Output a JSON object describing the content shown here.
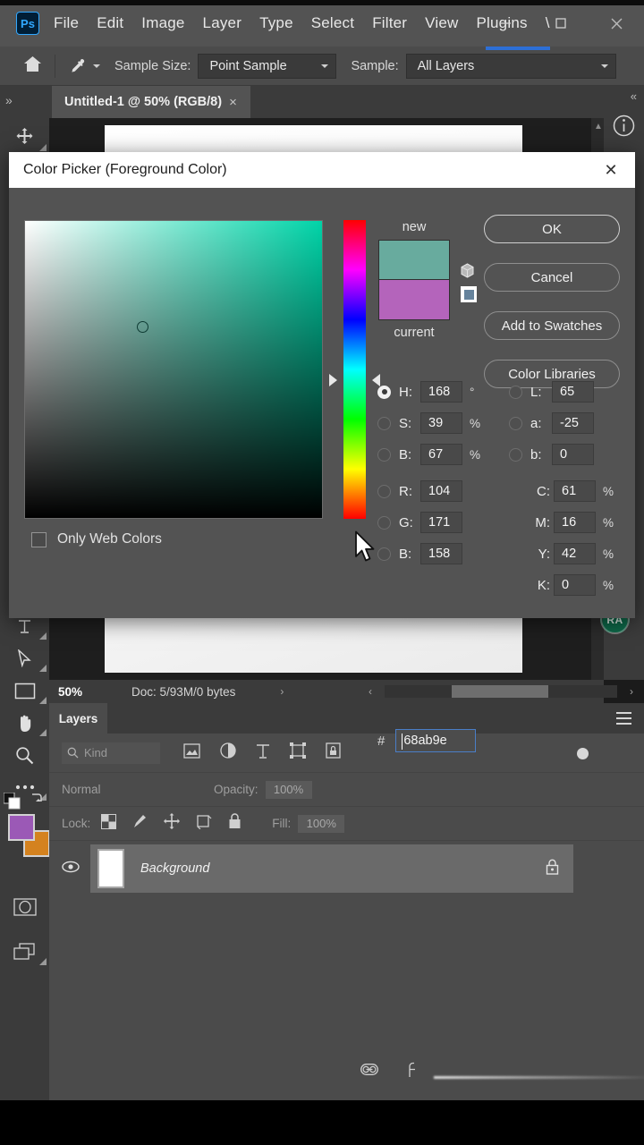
{
  "app": {
    "logo_text": "Ps",
    "menu_items": [
      "File",
      "Edit",
      "Image",
      "Layer",
      "Type",
      "Select",
      "Filter",
      "View",
      "Plugins",
      "\\"
    ],
    "window_controls": {
      "minimize": "minimize-icon",
      "maximize": "maximize-icon",
      "close": "close-icon"
    }
  },
  "options_bar": {
    "home_icon": "home-icon",
    "tool_icon": "eyedropper-icon",
    "sample_size_label": "Sample Size:",
    "sample_size_value": "Point Sample",
    "sample_label": "Sample:",
    "sample_value": "All Layers"
  },
  "document": {
    "tab_title": "Untitled-1 @ 50% (RGB/8)",
    "tab_close": "×",
    "expand_left": "»",
    "expand_right": "«"
  },
  "status_bar": {
    "zoom": "50%",
    "doc_info": "Doc: 5/93M/0 bytes",
    "chevron": "›",
    "scroll_left": "‹",
    "scroll_right": "›"
  },
  "toolbar": {
    "tools": [
      {
        "name": "move-tool",
        "glyph": "✥"
      },
      {
        "name": "type-tool",
        "glyph": "⊥"
      },
      {
        "name": "path-selection-tool",
        "glyph": "➤"
      },
      {
        "name": "rectangle-tool",
        "glyph": "▭"
      },
      {
        "name": "hand-tool",
        "glyph": "✋"
      },
      {
        "name": "zoom-tool",
        "glyph": "⌕"
      },
      {
        "name": "more-tools",
        "glyph": "•••"
      }
    ],
    "foreground_color": "#9b59b6",
    "background_color": "#d4821f",
    "swap_icon": "swap-colors-icon",
    "quick_mask": "quick-mask-icon",
    "screen_mode": "screen-mode-icon"
  },
  "right_dock": {
    "info_icon": "info-icon",
    "collapse": "«",
    "badge_text": "RA"
  },
  "layers_panel": {
    "tab_label": "Layers",
    "menu_icon": "panel-menu-icon",
    "filter_kind": "Kind",
    "filter_icons": [
      "pixel-filter-icon",
      "adjustment-filter-icon",
      "type-filter-icon",
      "shape-filter-icon",
      "smart-object-filter-icon"
    ],
    "blend_mode": "Normal",
    "opacity_label": "Opacity:",
    "opacity_value": "100%",
    "lock_label": "Lock:",
    "lock_icons": [
      "lock-transparent-icon",
      "lock-image-icon",
      "lock-position-icon",
      "lock-artboard-icon",
      "lock-all-icon"
    ],
    "fill_label": "Fill:",
    "fill_value": "100%",
    "rows": [
      {
        "name": "Background",
        "visible": true,
        "locked": true,
        "thumb_color": "#ffffff"
      }
    ],
    "footer_icons": [
      "link-layers-icon",
      "layer-fx-icon"
    ]
  },
  "color_picker": {
    "title": "Color Picker (Foreground Color)",
    "close_label": "✕",
    "buttons": [
      {
        "label": "OK",
        "name": "ok-button",
        "primary": true
      },
      {
        "label": "Cancel",
        "name": "cancel-button",
        "primary": false
      },
      {
        "label": "Add to Swatches",
        "name": "add-to-swatches-button",
        "primary": false
      },
      {
        "label": "Color Libraries",
        "name": "color-libraries-button",
        "primary": false
      }
    ],
    "new_label": "new",
    "current_label": "current",
    "new_color": "#68ab9e",
    "current_color": "#b濟",
    "current_color_hex": "#b464bb",
    "only_web_colors_label": "Only Web Colors",
    "only_web_colors_checked": false,
    "field_hue_color": "#00d4a8",
    "selected_model": "H",
    "hsb": {
      "h_label": "H:",
      "h_value": "168",
      "h_unit": "°",
      "s_label": "S:",
      "s_value": "39",
      "s_unit": "%",
      "b_label": "B:",
      "b_value": "67",
      "b_unit": "%"
    },
    "lab": {
      "l_label": "L:",
      "l_value": "65",
      "a_label": "a:",
      "a_value": "-25",
      "b_label": "b:",
      "b_value": "0"
    },
    "rgb": {
      "r_label": "R:",
      "r_value": "104",
      "g_label": "G:",
      "g_value": "171",
      "b_label": "B:",
      "b_value": "158"
    },
    "cmyk": {
      "c_label": "C:",
      "c_value": "61",
      "c_unit": "%",
      "m_label": "M:",
      "m_value": "16",
      "m_unit": "%",
      "y_label": "Y:",
      "y_value": "42",
      "y_unit": "%",
      "k_label": "K:",
      "k_value": "0",
      "k_unit": "%"
    },
    "hex_symbol": "#",
    "hex_value": "68ab9e",
    "out_of_gamut_icon": "gamut-warning-icon",
    "web_safe_icon": "web-safe-warning-icon"
  }
}
